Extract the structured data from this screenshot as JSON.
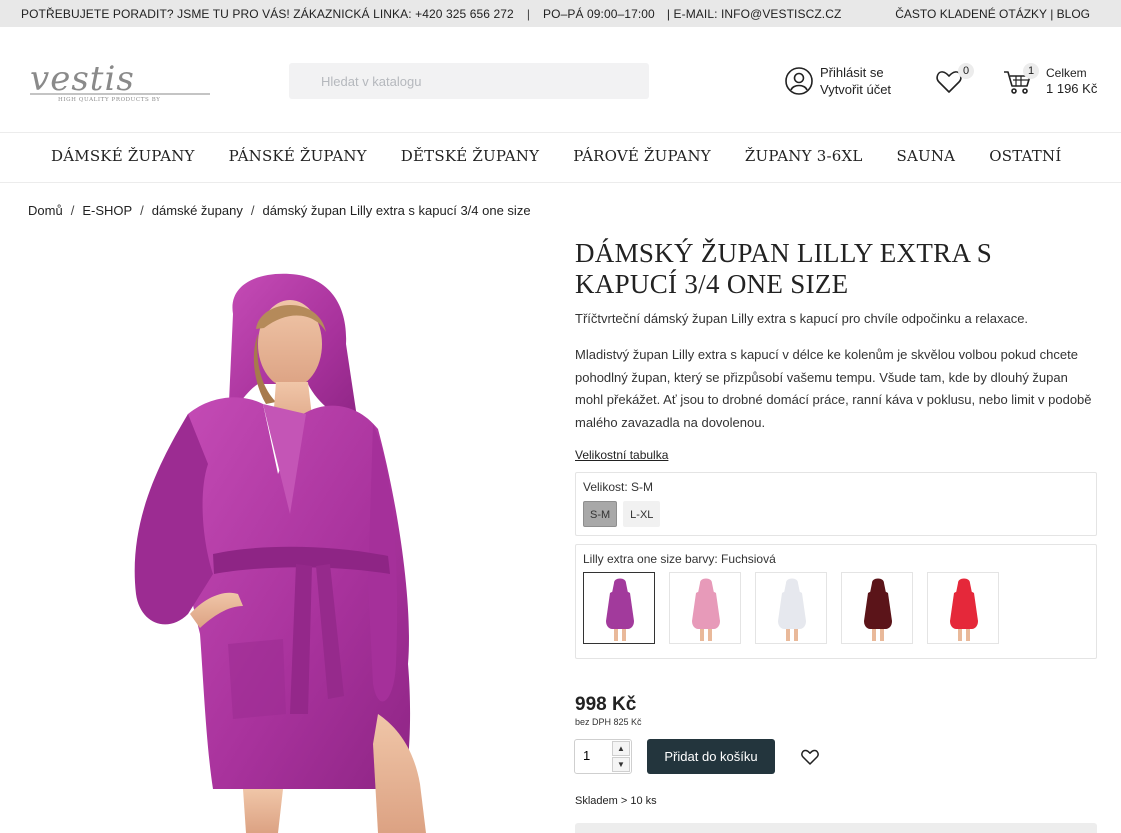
{
  "topbar": {
    "help_text": "POTŘEBUJETE PORADIT? JSME TU PRO VÁS! ZÁKAZNICKÁ LINKA: +420 325 656 272",
    "hours": "PO–PÁ 09:00–17:00",
    "email": "| E-MAIL: INFO@VESTISCZ.CZ",
    "faq": "ČASTO KLADENÉ OTÁZKY",
    "blog": "BLOG"
  },
  "header": {
    "logo_text": "vestis",
    "logo_tagline": "HIGH QUALITY PRODUCTS BY",
    "search_placeholder": "Hledat v katalogu",
    "login": "Přihlásit se",
    "register": "Vytvořit účet",
    "wishlist_count": "0",
    "cart_count": "1",
    "cart_label": "Celkem",
    "cart_total": "1 196 Kč"
  },
  "nav": {
    "items": [
      "DÁMSKÉ ŽUPANY",
      "PÁNSKÉ ŽUPANY",
      "DĚTSKÉ ŽUPANY",
      "PÁROVÉ ŽUPANY",
      "ŽUPANY 3-6XL",
      "SAUNA",
      "OSTATNÍ"
    ]
  },
  "breadcrumb": [
    "Domů",
    "E-SHOP",
    "dámské župany",
    "dámský župan Lilly extra s kapucí 3/4 one size"
  ],
  "product": {
    "title": "DÁMSKÝ ŽUPAN LILLY EXTRA S KAPUCÍ 3/4 ONE SIZE",
    "subtitle": "Tříčtvrteční dámský župan Lilly extra s kapucí pro chvíle odpočinku a relaxace.",
    "description": "Mladistvý župan Lilly extra s kapucí v délce ke kolenům je skvělou volbou pokud chcete pohodlný župan, který se přizpůsobí vašemu tempu. Všude tam, kde by dlouhý župan mohl překážet. Ať jsou to drobné domácí práce, ranní káva v poklusu, nebo limit v podobě malého zavazadla na dovolenou.",
    "size_table_link": "Velikostní tabulka",
    "size_label": "Velikost: S-M",
    "sizes": [
      "S-M",
      "L-XL"
    ],
    "selected_size": "S-M",
    "color_label": "Lilly extra one size barvy: Fuchsiová",
    "color_swatches": [
      {
        "name": "Fuchsiová",
        "color": "#a23a9c"
      },
      {
        "name": "pink",
        "color": "#e79ab9"
      },
      {
        "name": "white",
        "color": "#e6e8ee"
      },
      {
        "name": "burgundy",
        "color": "#5b1419"
      },
      {
        "name": "red",
        "color": "#e5283a"
      }
    ],
    "price": "998 Kč",
    "price_no_vat": "bez DPH 825 Kč",
    "quantity": "1",
    "add_to_cart": "Přidat do košíku",
    "stock": "Skladem > 10 ks"
  },
  "colors": {
    "robe": "#b43da7",
    "button": "#23353d",
    "topbar_bg": "#e8e8e8"
  }
}
